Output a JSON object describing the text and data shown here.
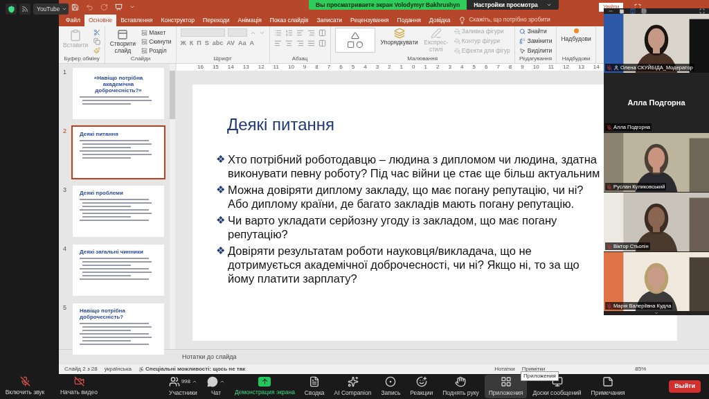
{
  "top_overlay": {
    "stream": "YouTube"
  },
  "share_banner": {
    "text": "Вы просматриваете экран Volodymyr Bakhrushyn",
    "options": "Настройки просмотра"
  },
  "powerpoint": {
    "sign_in": "Увійти",
    "tabs": [
      {
        "label": "Файл",
        "selected": false
      },
      {
        "label": "Основне",
        "selected": true
      },
      {
        "label": "Вставлення",
        "selected": false
      },
      {
        "label": "Конструктор",
        "selected": false
      },
      {
        "label": "Переходи",
        "selected": false
      },
      {
        "label": "Анімація",
        "selected": false
      },
      {
        "label": "Показ слайдів",
        "selected": false
      },
      {
        "label": "Записати",
        "selected": false
      },
      {
        "label": "Рецензування",
        "selected": false
      },
      {
        "label": "Подання",
        "selected": false
      },
      {
        "label": "Довідка",
        "selected": false
      }
    ],
    "tell_me": "Скажіть, що потрібно зробити",
    "ribbon": [
      {
        "kind": "clipboard",
        "label": "Буфер обміну",
        "items": [
          {
            "label": "Вставити",
            "disabled": true
          }
        ]
      },
      {
        "kind": "slides",
        "label": "Слайди",
        "items": [
          {
            "label": "Створити слайд",
            "disabled": false
          },
          {
            "label": "Макет",
            "disabled": false
          },
          {
            "label": "Скинути",
            "disabled": false
          },
          {
            "label": "Розділ",
            "disabled": false
          }
        ]
      },
      {
        "kind": "font",
        "label": "Шрифт",
        "items": [
          {
            "label": "Ж",
            "disabled": false
          },
          {
            "label": "К",
            "disabled": false
          },
          {
            "label": "П",
            "disabled": false
          },
          {
            "label": "S",
            "disabled": false
          },
          {
            "label": "abc",
            "disabled": false
          },
          {
            "label": "AV",
            "disabled": false
          },
          {
            "label": "Aa",
            "disabled": false
          },
          {
            "label": "A",
            "disabled": false
          }
        ]
      },
      {
        "kind": "paragraph",
        "label": "Абзац"
      },
      {
        "kind": "drawing",
        "label": "Малювання",
        "items": [
          {
            "label": "Упорядкувати",
            "disabled": false
          },
          {
            "label": "Експрес-стилі",
            "disabled": true
          },
          {
            "label": "Заливка фігури",
            "disabled": true
          },
          {
            "label": "Контур фігури",
            "disabled": true
          },
          {
            "label": "Ефекти для фігур",
            "disabled": true
          }
        ]
      },
      {
        "kind": "editing",
        "label": "Редагування",
        "items": [
          {
            "label": "Знайти",
            "disabled": false
          },
          {
            "label": "Замінити",
            "disabled": false
          },
          {
            "label": "Виділити",
            "disabled": false
          }
        ]
      },
      {
        "kind": "addins",
        "label": "Надбудови",
        "items": [
          {
            "label": "Надбудови",
            "disabled": false
          }
        ]
      }
    ],
    "ruler": [
      "16",
      "15",
      "14",
      "13",
      "12",
      "11",
      "10",
      "9",
      "8",
      "7",
      "6",
      "5",
      "4",
      "3",
      "2",
      "1",
      "0",
      "1",
      "2",
      "3",
      "4",
      "5",
      "6",
      "7",
      "8",
      "9",
      "10",
      "11",
      "12",
      "13",
      "14"
    ],
    "thumbnails": [
      {
        "number": "1",
        "title": "«Навіщо потрібна академічна доброчесність?»",
        "kind": "title",
        "selected": false
      },
      {
        "number": "2",
        "title": "Деякі питання",
        "kind": "content",
        "selected": true
      },
      {
        "number": "3",
        "title": "Деякі проблеми",
        "kind": "content",
        "selected": false
      },
      {
        "number": "4",
        "title": "Деякі загальні чинники",
        "kind": "content",
        "selected": false
      },
      {
        "number": "5",
        "title": "Навіщо потрібна доброчесність?",
        "kind": "content",
        "selected": false
      }
    ],
    "slide": {
      "title": "Деякі питання",
      "bullet": "❖",
      "bullets": [
        "Хто потрібний роботодавцю – людина з дипломом чи людина, здатна виконувати певну роботу? Під час війни це стає ще більш актуальним",
        "Можна довіряти диплому закладу, що має погану репутацію, чи ні? Або диплому країни, де багато закладів мають погану репутацію.",
        "Чи варто укладати серйозну угоду із закладом, що має погану репутацію?",
        "Довіряти результатам роботи науковця/викладача, що не дотримується академічної доброчесності, чи ні? Якщо ні, то за що йому платити зарплату?"
      ]
    },
    "notes_placeholder": "Нотатки до слайда",
    "status": {
      "slide": "Слайд 2 з 28",
      "language": "українська",
      "accessibility": "Спеціальні можливості: щось не так",
      "notes": "Нотатки",
      "comments": "Примітки",
      "zoom": "85%"
    }
  },
  "participants": [
    {
      "name": "Олена СКУЙБІДА_Модератор",
      "kind": "video",
      "speaking": true,
      "badge": true
    },
    {
      "name": "Алла Подгорна",
      "kind": "name",
      "display_name": "Алла Подгорна",
      "speaking": false,
      "badge": false
    },
    {
      "name": "Руслан Куликовський",
      "kind": "video",
      "speaking": false,
      "badge": false
    },
    {
      "name": "Віктор Стьопін",
      "kind": "video",
      "speaking": false,
      "badge": false
    },
    {
      "name": "Марія Валеріївна Кудла",
      "kind": "video",
      "speaking": false,
      "badge": false
    }
  ],
  "toolbar": {
    "audio": {
      "label": "Включить звук",
      "muted": true
    },
    "video": {
      "label": "Начать видео",
      "muted": true
    },
    "buttons": [
      {
        "label": "Участники",
        "kind": "participants",
        "count": "998",
        "menu": true,
        "selected": false
      },
      {
        "label": "Чат",
        "kind": "chat",
        "menu": true,
        "selected": false
      },
      {
        "label": "Демонстрация экрана",
        "kind": "share",
        "menu": false,
        "selected": false
      },
      {
        "label": "Сводка",
        "kind": "summary",
        "menu": false,
        "selected": false
      },
      {
        "label": "AI Companion",
        "kind": "ai",
        "menu": false,
        "selected": false
      },
      {
        "label": "Запись",
        "kind": "record",
        "menu": false,
        "selected": false
      },
      {
        "label": "Реакции",
        "kind": "reactions",
        "menu": false,
        "selected": false
      },
      {
        "label": "Поднять руку",
        "kind": "hand",
        "menu": false,
        "selected": false
      },
      {
        "label": "Приложения",
        "kind": "apps",
        "menu": false,
        "selected": true
      },
      {
        "label": "Доски сообщений",
        "kind": "boards",
        "menu": false,
        "selected": false
      },
      {
        "label": "Примечания",
        "kind": "notes",
        "menu": false,
        "selected": false
      }
    ],
    "leave": "Выйти"
  },
  "tooltip": "Приложения"
}
